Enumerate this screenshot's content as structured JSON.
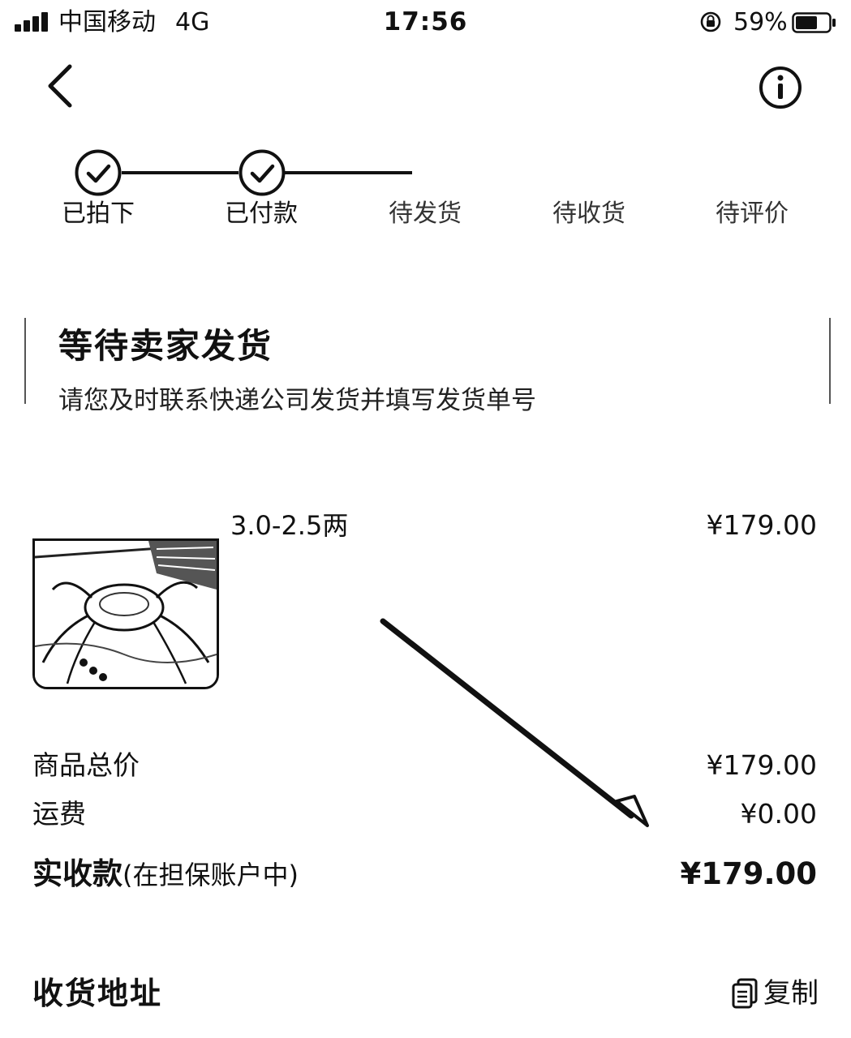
{
  "status_bar": {
    "carrier": "中国移动",
    "network": "4G",
    "time": "17:56",
    "battery": "59%"
  },
  "nav": {
    "back_icon": "chevron-left-icon",
    "info_icon": "info-icon"
  },
  "steps": [
    {
      "label": "已拍下",
      "state": "done"
    },
    {
      "label": "已付款",
      "state": "done"
    },
    {
      "label": "待发货",
      "state": "pending"
    },
    {
      "label": "待收货",
      "state": "pending"
    },
    {
      "label": "待评价",
      "state": "pending"
    }
  ],
  "status_card": {
    "title": "等待卖家发货",
    "description": "请您及时联系快递公司发货并填写发货单号"
  },
  "product": {
    "title": "3.0-2.5两",
    "price": "¥179.00",
    "image_icon": "crab-photo"
  },
  "summary": {
    "subtotal_label": "商品总价",
    "subtotal_value": "¥179.00",
    "shipping_label": "运费",
    "shipping_value": "¥0.00",
    "total_label": "实收款",
    "total_note": "(在担保账户中)",
    "total_value": "¥179.00"
  },
  "address": {
    "title": "收货地址",
    "copy_label": "复制",
    "copy_icon": "copy-icon"
  },
  "colors": {
    "text": "#111111",
    "background": "#ffffff"
  }
}
